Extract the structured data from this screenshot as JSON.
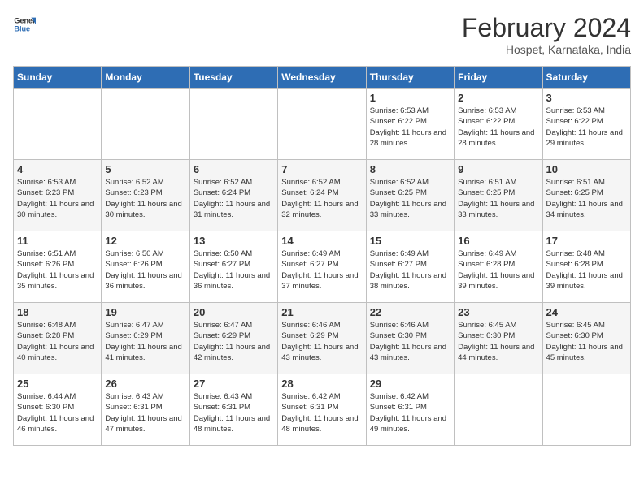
{
  "header": {
    "logo_general": "General",
    "logo_blue": "Blue",
    "month_year": "February 2024",
    "location": "Hospet, Karnataka, India"
  },
  "weekdays": [
    "Sunday",
    "Monday",
    "Tuesday",
    "Wednesday",
    "Thursday",
    "Friday",
    "Saturday"
  ],
  "weeks": [
    [
      {
        "day": "",
        "info": ""
      },
      {
        "day": "",
        "info": ""
      },
      {
        "day": "",
        "info": ""
      },
      {
        "day": "",
        "info": ""
      },
      {
        "day": "1",
        "info": "Sunrise: 6:53 AM\nSunset: 6:22 PM\nDaylight: 11 hours and 28 minutes."
      },
      {
        "day": "2",
        "info": "Sunrise: 6:53 AM\nSunset: 6:22 PM\nDaylight: 11 hours and 28 minutes."
      },
      {
        "day": "3",
        "info": "Sunrise: 6:53 AM\nSunset: 6:22 PM\nDaylight: 11 hours and 29 minutes."
      }
    ],
    [
      {
        "day": "4",
        "info": "Sunrise: 6:53 AM\nSunset: 6:23 PM\nDaylight: 11 hours and 30 minutes."
      },
      {
        "day": "5",
        "info": "Sunrise: 6:52 AM\nSunset: 6:23 PM\nDaylight: 11 hours and 30 minutes."
      },
      {
        "day": "6",
        "info": "Sunrise: 6:52 AM\nSunset: 6:24 PM\nDaylight: 11 hours and 31 minutes."
      },
      {
        "day": "7",
        "info": "Sunrise: 6:52 AM\nSunset: 6:24 PM\nDaylight: 11 hours and 32 minutes."
      },
      {
        "day": "8",
        "info": "Sunrise: 6:52 AM\nSunset: 6:25 PM\nDaylight: 11 hours and 33 minutes."
      },
      {
        "day": "9",
        "info": "Sunrise: 6:51 AM\nSunset: 6:25 PM\nDaylight: 11 hours and 33 minutes."
      },
      {
        "day": "10",
        "info": "Sunrise: 6:51 AM\nSunset: 6:25 PM\nDaylight: 11 hours and 34 minutes."
      }
    ],
    [
      {
        "day": "11",
        "info": "Sunrise: 6:51 AM\nSunset: 6:26 PM\nDaylight: 11 hours and 35 minutes."
      },
      {
        "day": "12",
        "info": "Sunrise: 6:50 AM\nSunset: 6:26 PM\nDaylight: 11 hours and 36 minutes."
      },
      {
        "day": "13",
        "info": "Sunrise: 6:50 AM\nSunset: 6:27 PM\nDaylight: 11 hours and 36 minutes."
      },
      {
        "day": "14",
        "info": "Sunrise: 6:49 AM\nSunset: 6:27 PM\nDaylight: 11 hours and 37 minutes."
      },
      {
        "day": "15",
        "info": "Sunrise: 6:49 AM\nSunset: 6:27 PM\nDaylight: 11 hours and 38 minutes."
      },
      {
        "day": "16",
        "info": "Sunrise: 6:49 AM\nSunset: 6:28 PM\nDaylight: 11 hours and 39 minutes."
      },
      {
        "day": "17",
        "info": "Sunrise: 6:48 AM\nSunset: 6:28 PM\nDaylight: 11 hours and 39 minutes."
      }
    ],
    [
      {
        "day": "18",
        "info": "Sunrise: 6:48 AM\nSunset: 6:28 PM\nDaylight: 11 hours and 40 minutes."
      },
      {
        "day": "19",
        "info": "Sunrise: 6:47 AM\nSunset: 6:29 PM\nDaylight: 11 hours and 41 minutes."
      },
      {
        "day": "20",
        "info": "Sunrise: 6:47 AM\nSunset: 6:29 PM\nDaylight: 11 hours and 42 minutes."
      },
      {
        "day": "21",
        "info": "Sunrise: 6:46 AM\nSunset: 6:29 PM\nDaylight: 11 hours and 43 minutes."
      },
      {
        "day": "22",
        "info": "Sunrise: 6:46 AM\nSunset: 6:30 PM\nDaylight: 11 hours and 43 minutes."
      },
      {
        "day": "23",
        "info": "Sunrise: 6:45 AM\nSunset: 6:30 PM\nDaylight: 11 hours and 44 minutes."
      },
      {
        "day": "24",
        "info": "Sunrise: 6:45 AM\nSunset: 6:30 PM\nDaylight: 11 hours and 45 minutes."
      }
    ],
    [
      {
        "day": "25",
        "info": "Sunrise: 6:44 AM\nSunset: 6:30 PM\nDaylight: 11 hours and 46 minutes."
      },
      {
        "day": "26",
        "info": "Sunrise: 6:43 AM\nSunset: 6:31 PM\nDaylight: 11 hours and 47 minutes."
      },
      {
        "day": "27",
        "info": "Sunrise: 6:43 AM\nSunset: 6:31 PM\nDaylight: 11 hours and 48 minutes."
      },
      {
        "day": "28",
        "info": "Sunrise: 6:42 AM\nSunset: 6:31 PM\nDaylight: 11 hours and 48 minutes."
      },
      {
        "day": "29",
        "info": "Sunrise: 6:42 AM\nSunset: 6:31 PM\nDaylight: 11 hours and 49 minutes."
      },
      {
        "day": "",
        "info": ""
      },
      {
        "day": "",
        "info": ""
      }
    ]
  ]
}
